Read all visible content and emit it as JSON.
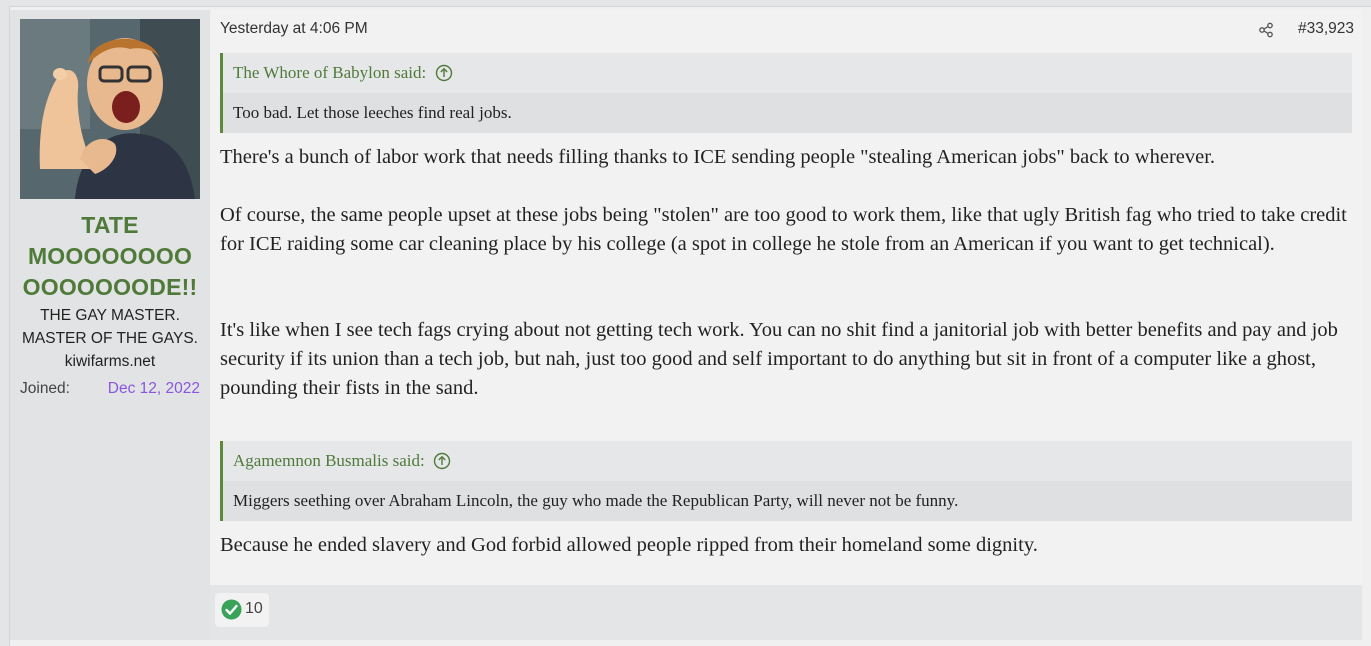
{
  "user": {
    "name_lines": [
      "TATE",
      "MOOOOOOOO",
      "OOOOOOODE!!"
    ],
    "title_lines": [
      "THE GAY MASTER.",
      "MASTER OF THE GAYS."
    ],
    "site": "kiwifarms.net",
    "joined_label": "Joined:",
    "joined_date": "Dec 12, 2022"
  },
  "post": {
    "date": "Yesterday at 4:06 PM",
    "number": "#33,923",
    "quote1": {
      "author": "The Whore of Babylon said:",
      "text": "Too bad. Let those leeches find real jobs."
    },
    "paragraphs": [
      "There's a bunch of labor work that needs filling thanks to ICE sending people \"stealing American jobs\" back to wherever.",
      "Of course, the same people upset at these jobs being \"stolen\" are too good to work them, like that ugly British fag who tried to take credit for ICE raiding some car cleaning place by his college (a spot in college he stole from an American if you want to get technical).",
      "It's like when I see tech fags crying about not getting tech work. You can no shit find a janitorial job with better benefits and pay and job security if its union than a tech job, but nah, just too good and self important to do anything but sit in front of a computer like a ghost, pounding their fists in the sand."
    ],
    "quote2": {
      "author": "Agamemnon Busmalis said:",
      "text": "Miggers seething over Abraham Lincoln, the guy who made the Republican Party, will never not be funny."
    },
    "final_paragraph": "Because he ended slavery and God forbid allowed people ripped from their homeland some dignity."
  },
  "reactions": {
    "icon": "checkmark-icon",
    "count": "10"
  },
  "colors": {
    "accent_green": "#4f7a3a",
    "joined_purple": "#8a56e0",
    "reaction_green": "#3aa35a"
  }
}
